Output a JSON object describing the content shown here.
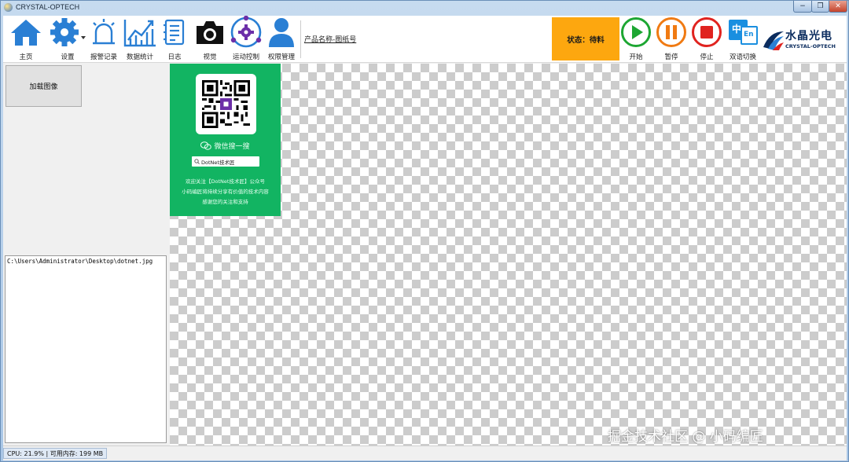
{
  "window": {
    "title": "CRYSTAL-OPTECH",
    "min_glyph": "−",
    "max_glyph": "❐",
    "close_glyph": "✕"
  },
  "toolbar": {
    "home": {
      "label": "主页",
      "icon": "home-icon"
    },
    "settings": {
      "label": "设置",
      "icon": "gear-icon"
    },
    "alarm": {
      "label": "报警记录",
      "icon": "alarm-icon"
    },
    "stats": {
      "label": "数据统计",
      "icon": "chart-icon"
    },
    "log": {
      "label": "日志",
      "icon": "log-icon"
    },
    "vision": {
      "label": "视觉",
      "icon": "camera-icon"
    },
    "motion": {
      "label": "运动控制",
      "icon": "motion-icon"
    },
    "permission": {
      "label": "权限管理",
      "icon": "user-icon"
    },
    "product_label": "产品名称-图纸号",
    "status_text": "状态：待料",
    "start": {
      "label": "开始",
      "icon": "play-icon"
    },
    "pause": {
      "label": "暂停",
      "icon": "pause-icon"
    },
    "stop": {
      "label": "停止",
      "icon": "stop-icon"
    },
    "language": {
      "label": "双语切换",
      "icon": "language-icon",
      "cn": "中",
      "en": "En"
    }
  },
  "logo": {
    "cn": "水晶光电",
    "en": "CRYSTAL-OPTECH"
  },
  "left_panel": {
    "load_button": "加载图像",
    "image_path": "C:\\Users\\Administrator\\Desktop\\dotnet.jpg"
  },
  "card": {
    "wechat_search": "微信搜一搜",
    "search_text": "DotNet技术匠",
    "lines": [
      "欢迎关注【DotNet技术匠】公众号",
      "小码编匠将持续分享有价值的技术内容",
      "感谢您的关注和支持"
    ]
  },
  "statusbar": {
    "text": "CPU: 21.9% | 可用内存: 199 MB"
  },
  "watermark": "掘金技术社区 @ 小码编匠",
  "colors": {
    "accent_blue": "#2a7fd4",
    "status_orange": "#fda70f",
    "start_green": "#1da632",
    "pause_orange": "#f07a12",
    "stop_red": "#e0231f",
    "card_green": "#12b462"
  }
}
